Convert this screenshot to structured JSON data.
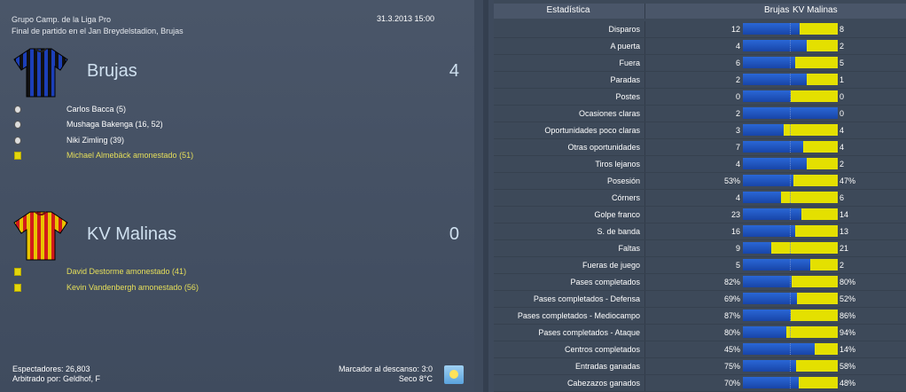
{
  "match": {
    "competition": "Grupo Camp. de la Liga Pro",
    "venue": "Final de partido en el Jan Breydelstadion, Brujas",
    "datetime": "31.3.2013 15:00"
  },
  "home": {
    "name": "Brujas",
    "score": "4",
    "events": [
      {
        "type": "goal",
        "text": "Carlos Bacca (5)"
      },
      {
        "type": "goal",
        "text": "Mushaga Bakenga (16, 52)"
      },
      {
        "type": "goal",
        "text": "Niki Zimling (39)"
      },
      {
        "type": "yellow",
        "text": "Michael Almebäck amonestado (51)"
      }
    ]
  },
  "away": {
    "name": "KV Malinas",
    "score": "0",
    "events": [
      {
        "type": "yellow",
        "text": "David Destorme amonestado (41)"
      },
      {
        "type": "yellow",
        "text": "Kevin Vandenbergh amonestado (56)"
      }
    ]
  },
  "footer": {
    "attendance": "Espectadores: 26,803",
    "referee": "Arbitrado por: Geldhof, F",
    "halftime": "Marcador al descanso: 3:0",
    "weather": "Seco 8°C",
    "weather_icon": "sun-icon"
  },
  "stats": {
    "header_label": "Estadística",
    "home_label": "Brujas",
    "away_label": "KV Malinas",
    "rows": [
      {
        "label": "Disparos",
        "home": "12",
        "away": "8",
        "home_share": 0.6
      },
      {
        "label": "A puerta",
        "home": "4",
        "away": "2",
        "home_share": 0.67
      },
      {
        "label": "Fuera",
        "home": "6",
        "away": "5",
        "home_share": 0.55
      },
      {
        "label": "Paradas",
        "home": "2",
        "away": "1",
        "home_share": 0.67
      },
      {
        "label": "Postes",
        "home": "0",
        "away": "0",
        "home_share": 0.5
      },
      {
        "label": "Ocasiones claras",
        "home": "2",
        "away": "0",
        "home_share": 1.0
      },
      {
        "label": "Oportunidades poco claras",
        "home": "3",
        "away": "4",
        "home_share": 0.43
      },
      {
        "label": "Otras oportunidades",
        "home": "7",
        "away": "4",
        "home_share": 0.64
      },
      {
        "label": "Tiros lejanos",
        "home": "4",
        "away": "2",
        "home_share": 0.67
      },
      {
        "label": "Posesión",
        "home": "53%",
        "away": "47%",
        "home_share": 0.53
      },
      {
        "label": "Córners",
        "home": "4",
        "away": "6",
        "home_share": 0.4
      },
      {
        "label": "Golpe franco",
        "home": "23",
        "away": "14",
        "home_share": 0.62
      },
      {
        "label": "S. de banda",
        "home": "16",
        "away": "13",
        "home_share": 0.55
      },
      {
        "label": "Faltas",
        "home": "9",
        "away": "21",
        "home_share": 0.3
      },
      {
        "label": "Fueras de juego",
        "home": "5",
        "away": "2",
        "home_share": 0.71
      },
      {
        "label": "Pases completados",
        "home": "82%",
        "away": "80%",
        "home_share": 0.51
      },
      {
        "label": "Pases completados - Defensa",
        "home": "69%",
        "away": "52%",
        "home_share": 0.57
      },
      {
        "label": "Pases completados - Mediocampo",
        "home": "87%",
        "away": "86%",
        "home_share": 0.5
      },
      {
        "label": "Pases completados - Ataque",
        "home": "80%",
        "away": "94%",
        "home_share": 0.46
      },
      {
        "label": "Centros completados",
        "home": "45%",
        "away": "14%",
        "home_share": 0.76
      },
      {
        "label": "Entradas ganadas",
        "home": "75%",
        "away": "58%",
        "home_share": 0.56
      },
      {
        "label": "Cabezazos ganados",
        "home": "70%",
        "away": "48%",
        "home_share": 0.59
      }
    ]
  },
  "colors": {
    "home_bar": "#1f55c4",
    "away_bar": "#e4e000",
    "card_yellow": "#e4d60b"
  }
}
